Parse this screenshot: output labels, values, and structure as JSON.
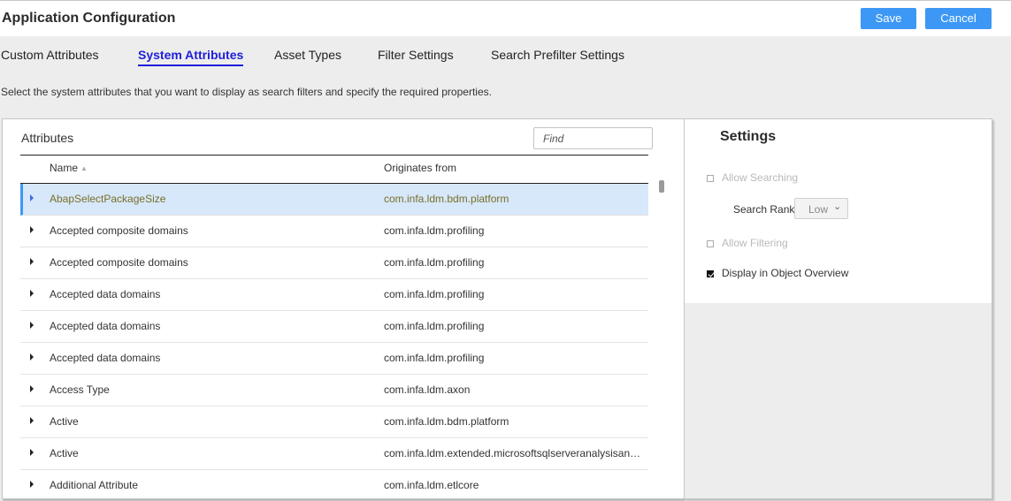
{
  "header": {
    "title": "Application Configuration",
    "save_label": "Save",
    "cancel_label": "Cancel",
    "accent_color": "#3d98f5"
  },
  "tabs": [
    {
      "label": "Custom Attributes",
      "active": false
    },
    {
      "label": "System Attributes",
      "active": true
    },
    {
      "label": "Asset Types",
      "active": false
    },
    {
      "label": "Filter Settings",
      "active": false
    },
    {
      "label": "Search Prefilter Settings",
      "active": false
    }
  ],
  "description": "Select the system attributes that you want to display as search filters and specify the required properties.",
  "attributes": {
    "title": "Attributes",
    "find_placeholder": "Find",
    "columns": {
      "name": "Name",
      "origin": "Originates from",
      "sort_icon": "sort-ascending-icon"
    },
    "rows": [
      {
        "name": "AbapSelectPackageSize",
        "origin": "com.infa.ldm.bdm.platform",
        "selected": true
      },
      {
        "name": "Accepted composite domains",
        "origin": "com.infa.ldm.profiling",
        "selected": false
      },
      {
        "name": "Accepted composite domains",
        "origin": "com.infa.ldm.profiling",
        "selected": false
      },
      {
        "name": "Accepted data domains",
        "origin": "com.infa.ldm.profiling",
        "selected": false
      },
      {
        "name": "Accepted data domains",
        "origin": "com.infa.ldm.profiling",
        "selected": false
      },
      {
        "name": "Accepted data domains",
        "origin": "com.infa.ldm.profiling",
        "selected": false
      },
      {
        "name": "Access Type",
        "origin": "com.infa.ldm.axon",
        "selected": false
      },
      {
        "name": "Active",
        "origin": "com.infa.ldm.bdm.platform",
        "selected": false
      },
      {
        "name": "Active",
        "origin": "com.infa.ldm.extended.microsoftsqlserveranalysisan…",
        "selected": false
      },
      {
        "name": "Additional Attribute",
        "origin": "com.infa.ldm.etlcore",
        "selected": false
      }
    ]
  },
  "settings": {
    "title": "Settings",
    "allow_searching": {
      "label": "Allow Searching",
      "checked": false,
      "disabled": true
    },
    "search_rank": {
      "label": "Search Rank",
      "value": "Low"
    },
    "allow_filtering": {
      "label": "Allow Filtering",
      "checked": false,
      "disabled": true
    },
    "display_overview": {
      "label": "Display in Object Overview",
      "checked": true,
      "disabled": false
    }
  }
}
